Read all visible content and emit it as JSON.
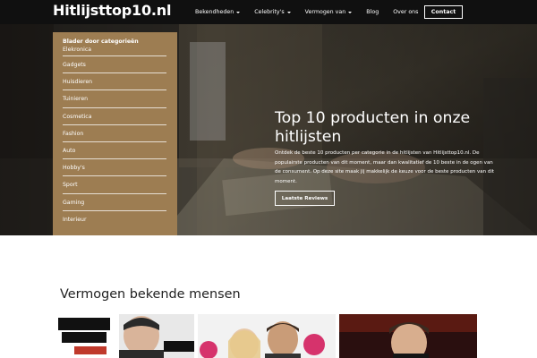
{
  "header": {
    "logo": "Hitlijsttop10.nl",
    "nav": [
      {
        "label": "Bekendheden",
        "dropdown": true
      },
      {
        "label": "Celebrity's",
        "dropdown": true
      },
      {
        "label": "Vermogen van",
        "dropdown": true
      },
      {
        "label": "Blog",
        "dropdown": false
      },
      {
        "label": "Over ons",
        "dropdown": false
      }
    ],
    "contact_label": "Contact"
  },
  "categories": {
    "heading": "Blader door categorieën",
    "first": "Elekronica",
    "items": [
      "Gadgets",
      "Huisdieren",
      "Tuinieren",
      "Cosmetica",
      "Fashion",
      "Auto",
      "Hobby's",
      "Sport",
      "Gaming",
      "Interieur"
    ]
  },
  "hero": {
    "title": "Top 10 producten in onze hitlijsten",
    "description": "Ontdek de beste 10 producten per categorie in de hitlijsten van Hitlijsttop10.nl. De populairste producten van dit moment, maar dan kwalitatief de 10 beste in de ogen van de consument. Op deze site maak jij makkelijk de keuze voor de beste producten van dit moment.",
    "button_label": "Laatste Reviews"
  },
  "section": {
    "title": "Vermogen bekende mensen"
  },
  "colors": {
    "header_bg": "#101010",
    "panel_bg": "#9d7d52",
    "text_dark": "#222222"
  }
}
